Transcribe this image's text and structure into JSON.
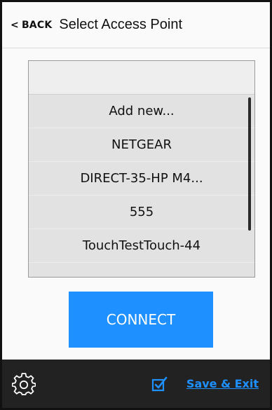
{
  "header": {
    "back_label": "BACK",
    "title": "Select Access Point"
  },
  "access_points": {
    "items": [
      {
        "label": "Add new..."
      },
      {
        "label": "NETGEAR"
      },
      {
        "label": "DIRECT-35-HP M4..."
      },
      {
        "label": "555"
      },
      {
        "label": "TouchTestTouch-44"
      }
    ]
  },
  "actions": {
    "connect_label": "CONNECT"
  },
  "footer": {
    "save_exit_label": "Save & Exit"
  },
  "colors": {
    "accent": "#1e90ff",
    "footer_bg": "#222222",
    "list_bg": "#e2e2e2"
  },
  "icons": {
    "back": "chevron-left-icon",
    "settings": "gear-icon",
    "save": "checkbox-check-icon"
  }
}
